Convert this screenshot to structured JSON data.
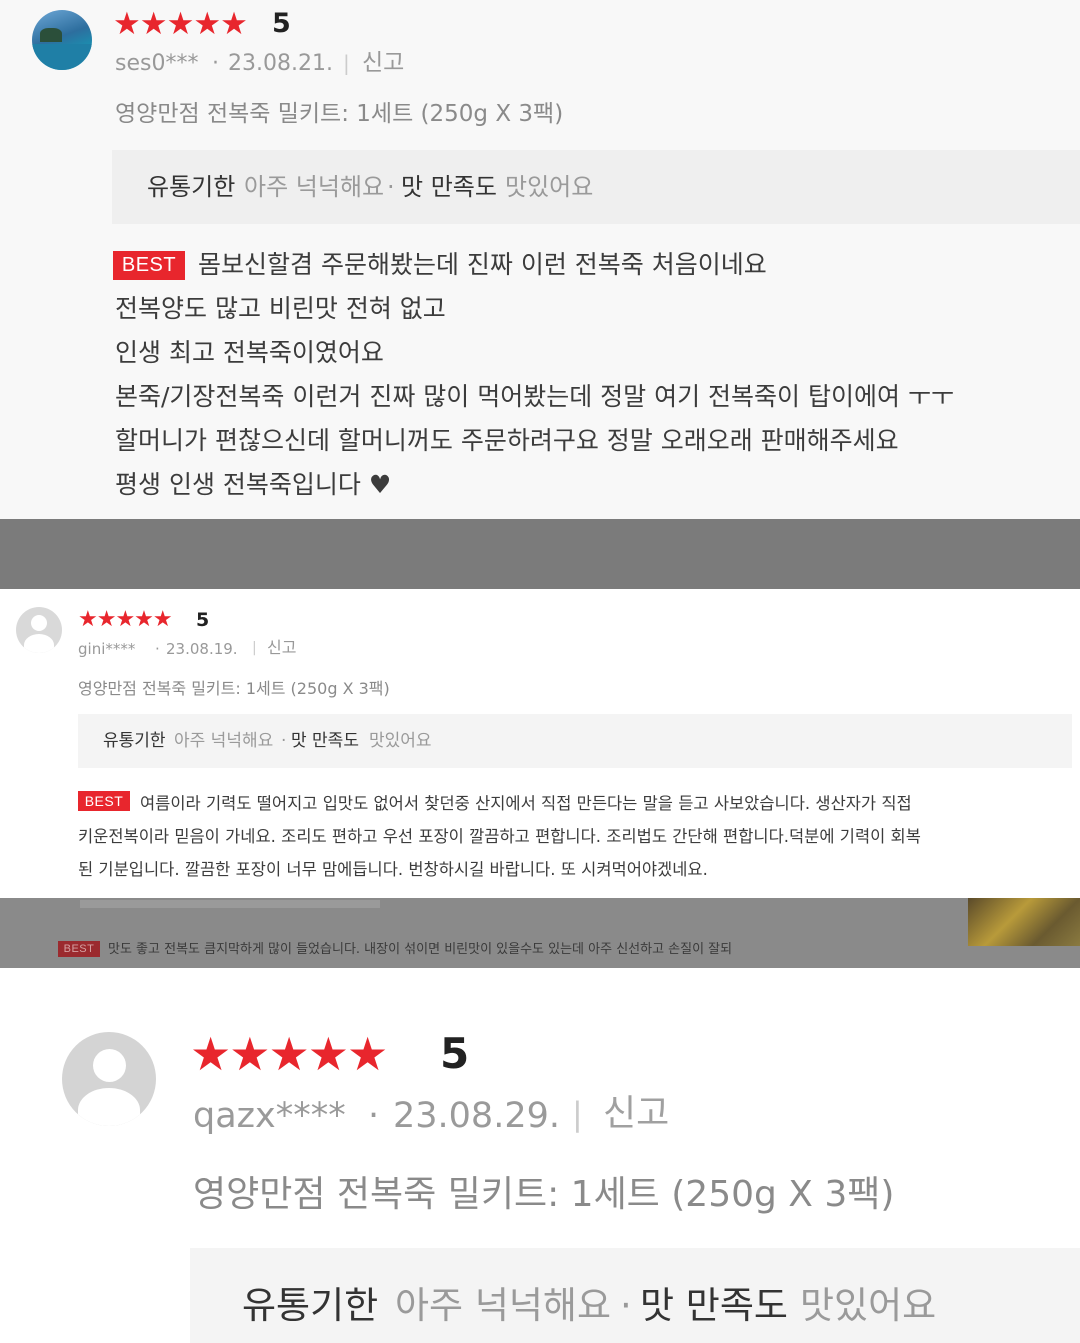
{
  "reviews": [
    {
      "stars": "★★★★★",
      "score": "5",
      "user": "ses0***",
      "sep": "·",
      "date": "23.08.21.",
      "divider": "|",
      "report": "신고",
      "option": "영양만점 전복죽 밀키트: 1세트 (250g X 3팩)",
      "tag1_key": "유통기한",
      "tag1_val": "아주 넉넉해요",
      "tag_sep": "·",
      "tag2_key": "맛 만족도",
      "tag2_val": "맛있어요",
      "best": "BEST",
      "body_lines": [
        "몸보신할겸 주문해봤는데 진짜 이런 전복죽 처음이네요",
        "전복양도 많고 비린맛 전혀 없고",
        "인생 최고 전복죽이였어요",
        "본죽/기장전복죽 이런거 진짜 많이 먹어봤는데 정말 여기 전복죽이 탑이에여 ㅜㅜ",
        "할머니가 편찮으신데 할머니꺼도 주문하려구요 정말 오래오래 판매해주세요",
        "평생 인생 전복죽입니다 ♥"
      ]
    },
    {
      "stars": "★★★★★",
      "score": "5",
      "user": "gini****",
      "sep": "·",
      "date": "23.08.19.",
      "divider": "|",
      "report": "신고",
      "option": "영양만점 전복죽 밀키트: 1세트 (250g X 3팩)",
      "tag1_key": "유통기한",
      "tag1_val": "아주 넉넉해요",
      "tag_sep": "·",
      "tag2_key": "맛 만족도",
      "tag2_val": "맛있어요",
      "best": "BEST",
      "body_lines": [
        "여름이라 기력도 떨어지고 입맛도 없어서 찾던중 산지에서 직접 만든다는 말을 듣고 사보았습니다. 생산자가 직접",
        "키운전복이라 믿음이 가네요. 조리도 편하고 우선 포장이 깔끔하고 편합니다. 조리법도 간단해 편합니다.덕분에 기력이 회복",
        "된 기분입니다. 깔끔한 포장이 너무 맘에듭니다. 번창하시길 바랍니다. 또 시켜먹어야겠네요."
      ]
    },
    {
      "stars": "★★★★★",
      "score": "5",
      "user": "qazx****",
      "sep": "·",
      "date": "23.08.29.",
      "divider": "|",
      "report": "신고",
      "option": "영양만점 전복죽 밀키트: 1세트 (250g X 3팩)",
      "tag1_key": "유통기한",
      "tag1_val": "아주 넉넉해요",
      "tag_sep": "·",
      "tag2_key": "맛 만족도",
      "tag2_val": "맛있어요"
    }
  ],
  "background_strip": {
    "best": "BEST",
    "text": "맛도 좋고 전복도 큼지막하게 많이 들었습니다. 내장이 섞이면 비린맛이 있을수도 있는데 아주 신선하고 손질이 잘되"
  },
  "colors": {
    "star": "#e8262d",
    "best_bg": "#e8262d",
    "tag_bg": "#f3f3f3",
    "gap": "#7b7b7b"
  }
}
